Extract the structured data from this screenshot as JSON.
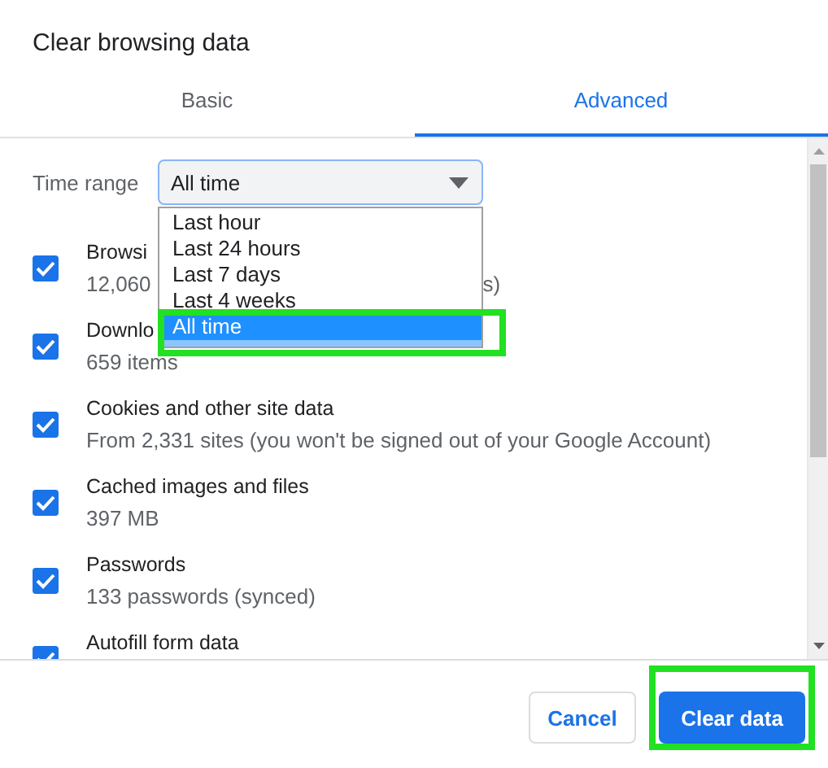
{
  "dialog": {
    "title": "Clear browsing data"
  },
  "tabs": [
    {
      "label": "Basic",
      "selected": false
    },
    {
      "label": "Advanced",
      "selected": true
    }
  ],
  "time_range": {
    "label": "Time range",
    "value": "All time",
    "expanded": true,
    "options": [
      {
        "label": "Last hour",
        "selected": false,
        "highlighted": false
      },
      {
        "label": "Last 24 hours",
        "selected": false,
        "highlighted": false
      },
      {
        "label": "Last 7 days",
        "selected": false,
        "highlighted": false
      },
      {
        "label": "Last 4 weeks",
        "selected": false,
        "highlighted": false
      },
      {
        "label": "All time",
        "selected": true,
        "highlighted": true
      }
    ]
  },
  "items": [
    {
      "title": "Browsi",
      "detail": [
        "12,060",
        "s)"
      ],
      "checked": true
    },
    {
      "title": "Downlo",
      "detail": [
        "659 items"
      ],
      "checked": true
    },
    {
      "title": "Cookies and other site data",
      "detail": [
        "From 2,331 sites (you won't be signed out of your Google Account)"
      ],
      "checked": true
    },
    {
      "title": "Cached images and files",
      "detail": [
        "397 MB"
      ],
      "checked": true
    },
    {
      "title": "Passwords",
      "detail": [
        "133 passwords (synced)"
      ],
      "checked": true
    },
    {
      "title": "Autofill form data",
      "checked": true
    }
  ],
  "buttons": [
    {
      "label": "Cancel",
      "kind": "secondary",
      "highlighted": false
    },
    {
      "label": "Clear data",
      "kind": "primary",
      "highlighted": true
    }
  ]
}
